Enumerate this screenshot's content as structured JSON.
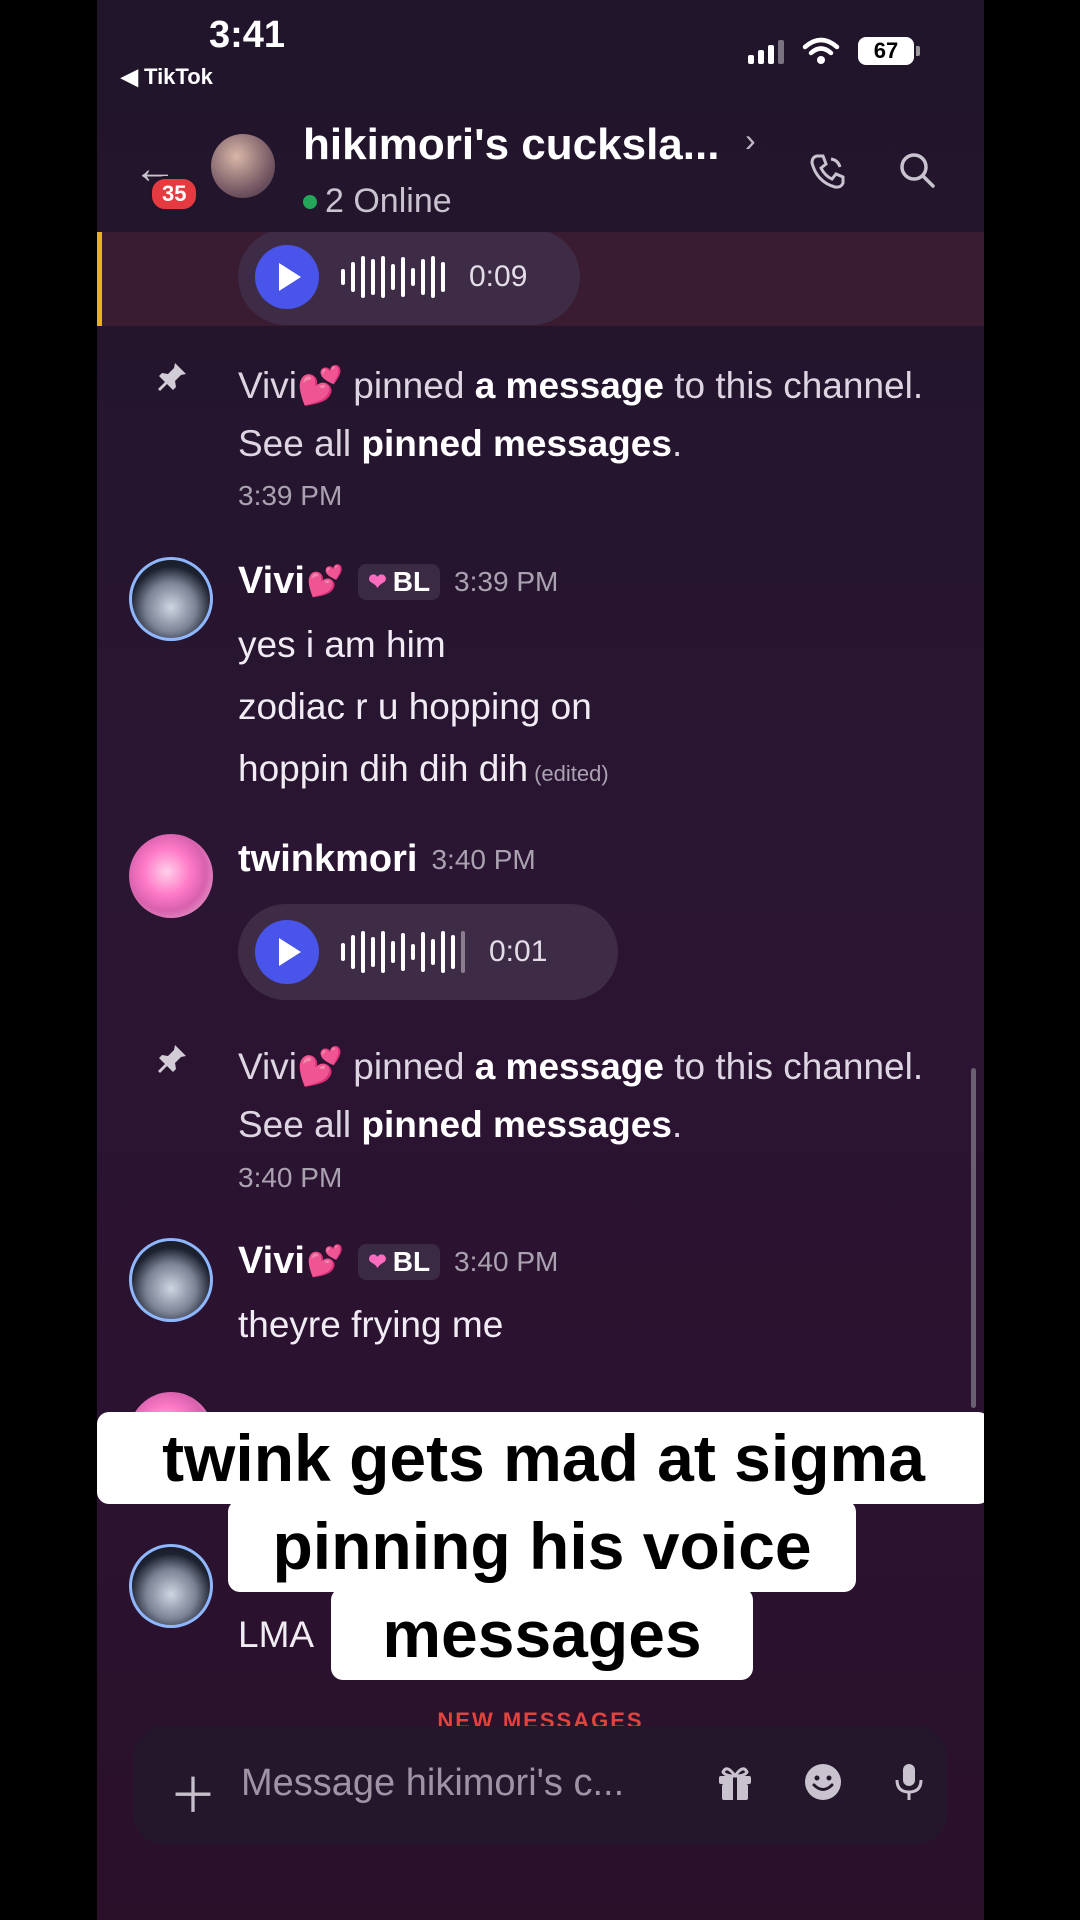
{
  "status_bar": {
    "time": "3:41",
    "back_app": "◀ TikTok",
    "battery": "67"
  },
  "header": {
    "back_icon": "arrow-left-icon",
    "unread_badge": "35",
    "title": "hikimori's cucksla...",
    "online": "2 Online",
    "chevron": "›"
  },
  "messages": {
    "voice1": {
      "duration": "0:09"
    },
    "pin1": {
      "user": "Vivi💕",
      "t1": " pinned ",
      "b1": "a message",
      "t2": " to this channel. See all ",
      "b2": "pinned messages",
      "t3": ".",
      "time": "3:39 PM"
    },
    "vivi1": {
      "author": "Vivi",
      "heart": "💕",
      "tag": "BL",
      "time": "3:39 PM",
      "line1": "yes i am him",
      "line2": "zodiac r u hopping on",
      "line3": "hoppin dih dih dih",
      "edited": "(edited)"
    },
    "twink1": {
      "author": "twinkmori",
      "time": "3:40 PM",
      "duration": "0:01"
    },
    "pin2": {
      "user": "Vivi💕",
      "t1": " pinned ",
      "b1": "a message",
      "t2": " to this channel. See all ",
      "b2": "pinned messages",
      "t3": ".",
      "time": "3:40 PM"
    },
    "vivi2": {
      "author": "Vivi",
      "heart": "💕",
      "tag": "BL",
      "time": "3:40 PM",
      "line1": "theyre frying me"
    },
    "vivi3": {
      "line1": "LMA"
    }
  },
  "caption": {
    "line1": "twink gets mad at sigma",
    "line2": "pinning his voice",
    "line3": "messages"
  },
  "new_messages_label": "NEW MESSAGES",
  "composer": {
    "placeholder": "Message hikimori's c...",
    "icons": [
      "plus-icon",
      "gift-icon",
      "emoji-icon",
      "microphone-icon"
    ]
  },
  "colors": {
    "accent": "#4954ea",
    "online": "#23a55a",
    "badge": "#e53a3f",
    "pinned_highlight": "#e3b322"
  }
}
